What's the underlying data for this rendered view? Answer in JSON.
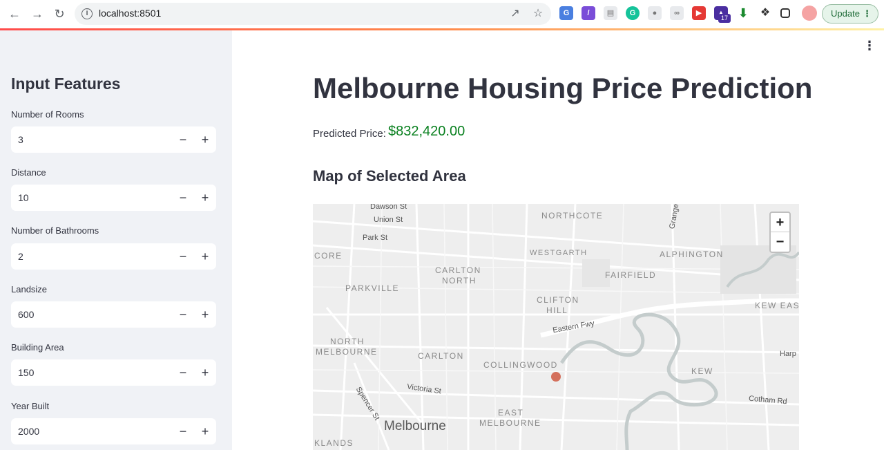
{
  "browser": {
    "url": "localhost:8501",
    "update_label": "Update",
    "ext_badge": "17"
  },
  "sidebar": {
    "title": "Input Features",
    "fields": [
      {
        "label": "Number of Rooms",
        "value": "3"
      },
      {
        "label": "Distance",
        "value": "10"
      },
      {
        "label": "Number of Bathrooms",
        "value": "2"
      },
      {
        "label": "Landsize",
        "value": "600"
      },
      {
        "label": "Building Area",
        "value": "150"
      },
      {
        "label": "Year Built",
        "value": "2000"
      }
    ],
    "minus": "−",
    "plus": "+"
  },
  "main": {
    "title": "Melbourne Housing Price Prediction",
    "predicted_label": "Predicted Price:",
    "predicted_value": "$832,420.00",
    "map_title": "Map of Selected Area"
  },
  "map": {
    "zoom_in": "+",
    "zoom_out": "−",
    "suburbs": [
      "NORTHCOTE",
      "WESTGARTH",
      "ALPHINGTON",
      "CORE",
      "CARLTON",
      "NORTH",
      "PARKVILLE",
      "FAIRFIELD",
      "CLIFTON",
      "HILL",
      "KEW EAS",
      "NORTH",
      "MELBOURNE",
      "CARLTON",
      "COLLINGWOOD",
      "KEW",
      "EAST",
      "MELBOURNE",
      "KLANDS"
    ],
    "streets": [
      "Dawson St",
      "Union St",
      "Park St",
      "Grange",
      "Eastern Fwy",
      "Harp",
      "Victoria St",
      "Spencer St",
      "Cotham Rd"
    ],
    "city": "Melbourne"
  },
  "colors": {
    "accent": "#ff4b4b",
    "price_green": "#09801f",
    "marker": "#d4705c",
    "sidebar_bg": "#f0f2f6"
  }
}
